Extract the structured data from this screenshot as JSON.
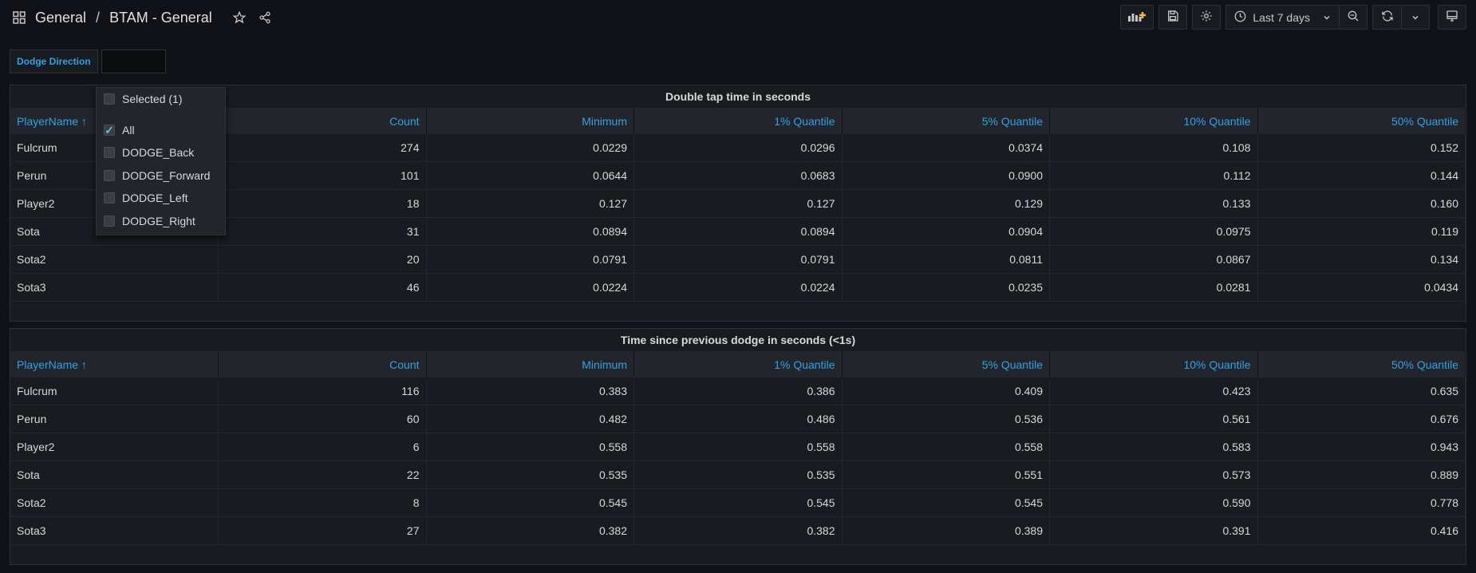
{
  "breadcrumb": {
    "folder": "General",
    "separator": "/",
    "dashboard": "BTAM - General"
  },
  "toolbar": {
    "time_range": "Last 7 days"
  },
  "variable": {
    "label": "Dodge Direction",
    "dropdown": {
      "selected_label": "Selected (1)",
      "options": [
        {
          "label": "All",
          "checked": true
        },
        {
          "label": "DODGE_Back",
          "checked": false
        },
        {
          "label": "DODGE_Forward",
          "checked": false
        },
        {
          "label": "DODGE_Left",
          "checked": false
        },
        {
          "label": "DODGE_Right",
          "checked": false
        }
      ]
    }
  },
  "panels": [
    {
      "title": "Double tap time in seconds",
      "columns": [
        "PlayerName ↑",
        "Count",
        "Minimum",
        "1% Quantile",
        "5% Quantile",
        "10% Quantile",
        "50% Quantile"
      ],
      "rows": [
        [
          "Fulcrum",
          "274",
          "0.0229",
          "0.0296",
          "0.0374",
          "0.108",
          "0.152"
        ],
        [
          "Perun",
          "101",
          "0.0644",
          "0.0683",
          "0.0900",
          "0.112",
          "0.144"
        ],
        [
          "Player2",
          "18",
          "0.127",
          "0.127",
          "0.129",
          "0.133",
          "0.160"
        ],
        [
          "Sota",
          "31",
          "0.0894",
          "0.0894",
          "0.0904",
          "0.0975",
          "0.119"
        ],
        [
          "Sota2",
          "20",
          "0.0791",
          "0.0791",
          "0.0811",
          "0.0867",
          "0.134"
        ],
        [
          "Sota3",
          "46",
          "0.0224",
          "0.0224",
          "0.0235",
          "0.0281",
          "0.0434"
        ]
      ]
    },
    {
      "title": "Time since previous dodge in seconds (<1s)",
      "columns": [
        "PlayerName ↑",
        "Count",
        "Minimum",
        "1% Quantile",
        "5% Quantile",
        "10% Quantile",
        "50% Quantile"
      ],
      "rows": [
        [
          "Fulcrum",
          "116",
          "0.383",
          "0.386",
          "0.409",
          "0.423",
          "0.635"
        ],
        [
          "Perun",
          "60",
          "0.482",
          "0.486",
          "0.536",
          "0.561",
          "0.676"
        ],
        [
          "Player2",
          "6",
          "0.558",
          "0.558",
          "0.558",
          "0.583",
          "0.943"
        ],
        [
          "Sota",
          "22",
          "0.535",
          "0.535",
          "0.551",
          "0.573",
          "0.889"
        ],
        [
          "Sota2",
          "8",
          "0.545",
          "0.545",
          "0.545",
          "0.590",
          "0.778"
        ],
        [
          "Sota3",
          "27",
          "0.382",
          "0.382",
          "0.389",
          "0.391",
          "0.416"
        ]
      ]
    }
  ],
  "colors": {
    "accent": "#33a2e5",
    "background": "#111217",
    "panel": "#181b1f"
  }
}
